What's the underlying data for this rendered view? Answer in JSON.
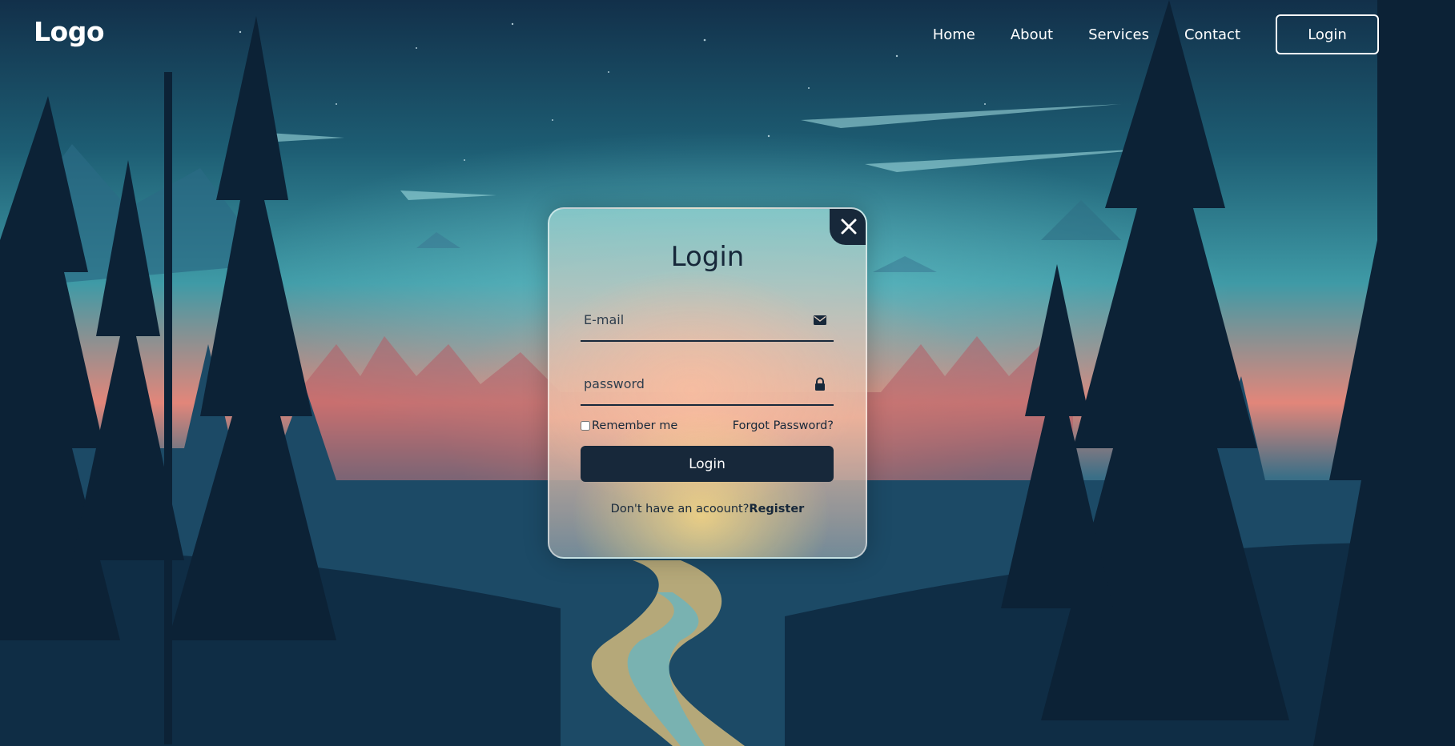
{
  "header": {
    "logo": "Logo",
    "nav": [
      "Home",
      "About",
      "Services",
      "Contact"
    ],
    "login_button": "Login"
  },
  "modal": {
    "title": "Login",
    "email": {
      "placeholder": "E-mail",
      "icon": "mail-icon"
    },
    "password": {
      "placeholder": "password",
      "icon": "lock-icon"
    },
    "remember_label": "Remember me",
    "remember_checked": false,
    "forgot_label": "Forgot Password?",
    "submit_label": "Login",
    "register_prompt": "Don't have an acoount?",
    "register_link": "Register",
    "close_icon": "close-icon"
  },
  "colors": {
    "dark": "#17283a",
    "white": "#ffffff"
  }
}
